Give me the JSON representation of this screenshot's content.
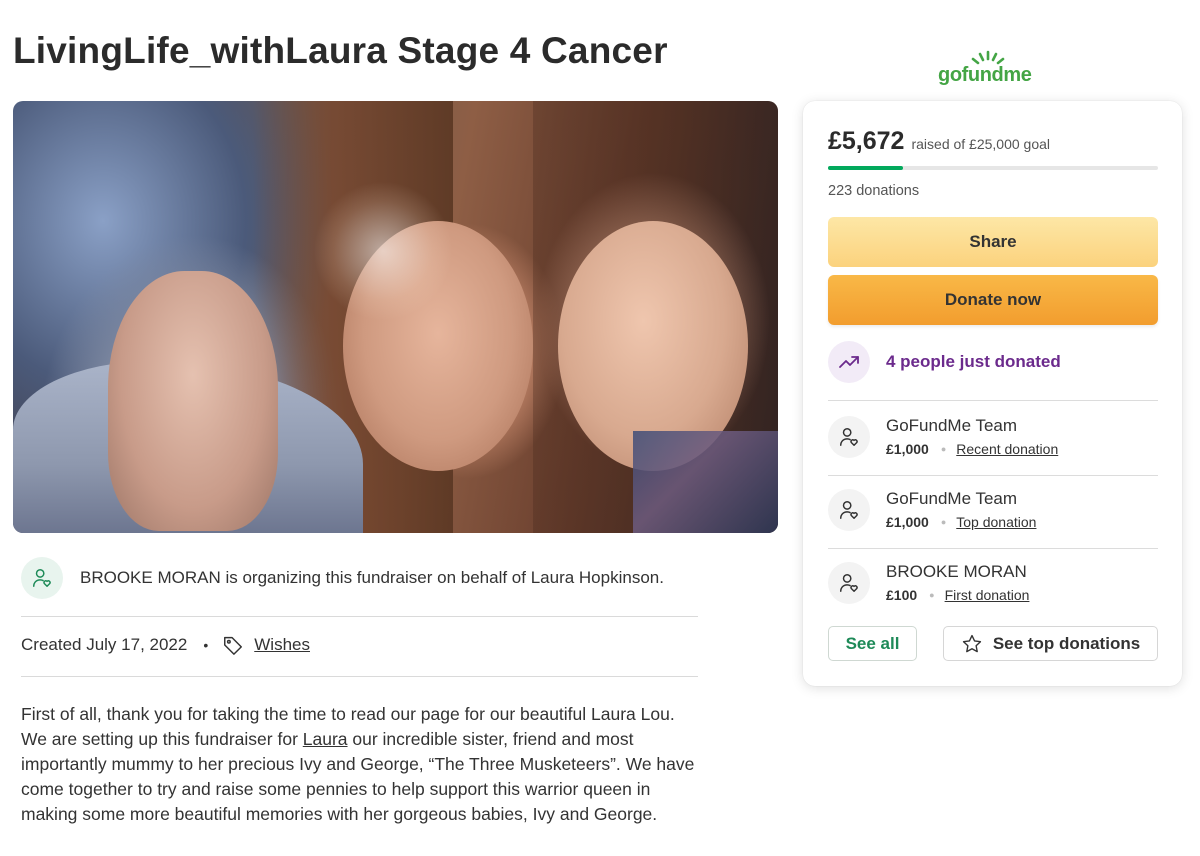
{
  "page": {
    "title": "LivingLife_withLaura Stage 4 Cancer"
  },
  "organizer": {
    "text": "BROOKE MORAN is organizing this fundraiser on behalf of Laura Hopkinson."
  },
  "meta": {
    "created": "Created July 17, 2022",
    "separator": "•",
    "category": "Wishes"
  },
  "story": {
    "line1": "First of all, thank you for taking the time to read our page for our beautiful Laura Lou.",
    "para2_before": "We are setting up this fundraiser for ",
    "para2_link": "Laura",
    "para2_after": " our incredible sister, friend and most importantly mummy to her precious Ivy and George, “The Three Musketeers”. We have come together to try and raise some pennies to help support this warrior queen in making some more beautiful memories with her gorgeous babies, Ivy and George."
  },
  "brand": {
    "logo": "gofundme",
    "color": "#44a545"
  },
  "card": {
    "raised": "£5,672",
    "goal_text": "raised of £25,000 goal",
    "progress_fraction": 0.227,
    "donations": "223 donations",
    "share_label": "Share",
    "donate_label": "Donate now",
    "recent_activity": "4 people just donated",
    "donors": [
      {
        "name": "GoFundMe Team",
        "amount": "£1,000",
        "type": "Recent donation"
      },
      {
        "name": "GoFundMe Team",
        "amount": "£1,000",
        "type": "Top donation"
      },
      {
        "name": "BROOKE MORAN",
        "amount": "£100",
        "type": "First donation"
      }
    ],
    "see_all_label": "See all",
    "see_top_label": "See top donations"
  },
  "icons": {
    "organizer": "user-heart-icon",
    "tag": "tag-icon",
    "trend": "trending-up-icon",
    "donor": "user-heart-icon",
    "star": "star-icon"
  },
  "colors": {
    "progress": "#02a95c",
    "accent_purple": "#6b2a8c",
    "donate": "#f29d2e",
    "share": "#fbd27d",
    "see_all": "#1e8a58"
  }
}
